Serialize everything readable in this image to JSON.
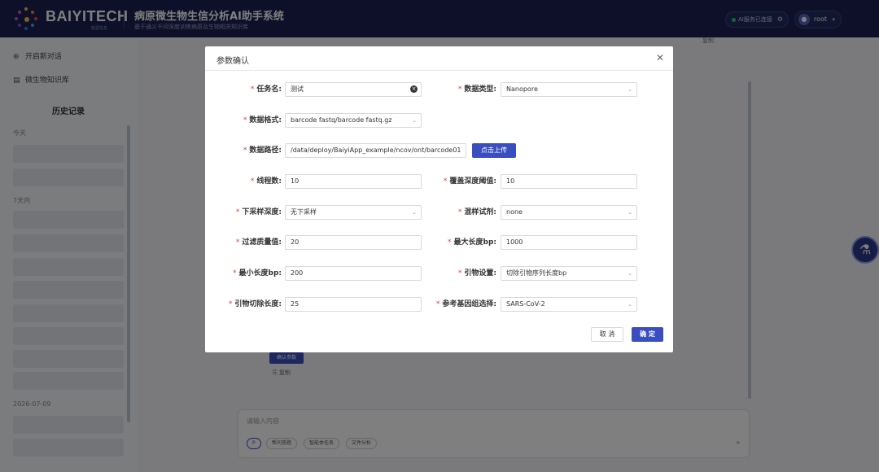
{
  "header": {
    "brand": "BAIYITECH",
    "brand_sub": "柏翌信息",
    "title": "病原微生物生信分析AI助手系统",
    "subtitle": "基于通义千问深度训练病原及生物相关知识库",
    "status": "AI服务已连接",
    "user": "root"
  },
  "sidebar": {
    "new_chat": "开启新对话",
    "knowledge_base": "微生物知识库",
    "history_title": "历史记录",
    "groups": [
      "今天",
      "7天内",
      "2026-07-09"
    ]
  },
  "main": {
    "copy_label": "复制",
    "confirm_params": "确认参数",
    "copy_label_2": "复制",
    "input_placeholder": "请输入内容",
    "chips": [
      "P",
      "帮问答题",
      "智能体任务",
      "文件分析"
    ]
  },
  "modal": {
    "title": "参数确认",
    "fields": {
      "task_name": {
        "label": "任务名:",
        "value": "测试"
      },
      "data_type": {
        "label": "数据类型:",
        "value": "Nanopore"
      },
      "data_format": {
        "label": "数据格式:",
        "value": "barcode fastq/barcode fastq.gz"
      },
      "data_path": {
        "label": "数据路径:",
        "value": "/data/deploy/BaiyiApp_example/ncov/ont/barcode01"
      },
      "threads": {
        "label": "线程数:",
        "value": "10"
      },
      "coverage_threshold": {
        "label": "覆盖深度阈值:",
        "value": "10"
      },
      "downsample_depth": {
        "label": "下采样深度:",
        "value": "无下采样"
      },
      "mixed_reagent": {
        "label": "混样试剂:",
        "value": "none"
      },
      "filter_quality": {
        "label": "过滤质量值:",
        "value": "20"
      },
      "max_length": {
        "label": "最大长度bp:",
        "value": "1000"
      },
      "min_length": {
        "label": "最小长度bp:",
        "value": "200"
      },
      "primer_setting": {
        "label": "引物设置:",
        "value": "切除引物序列长度bp"
      },
      "primer_trim_length": {
        "label": "引物切除长度:",
        "value": "25"
      },
      "reference_genome": {
        "label": "参考基因组选择:",
        "value": "SARS-CoV-2"
      }
    },
    "upload_label": "点击上传",
    "cancel_label": "取 消",
    "ok_label": "确 定"
  }
}
